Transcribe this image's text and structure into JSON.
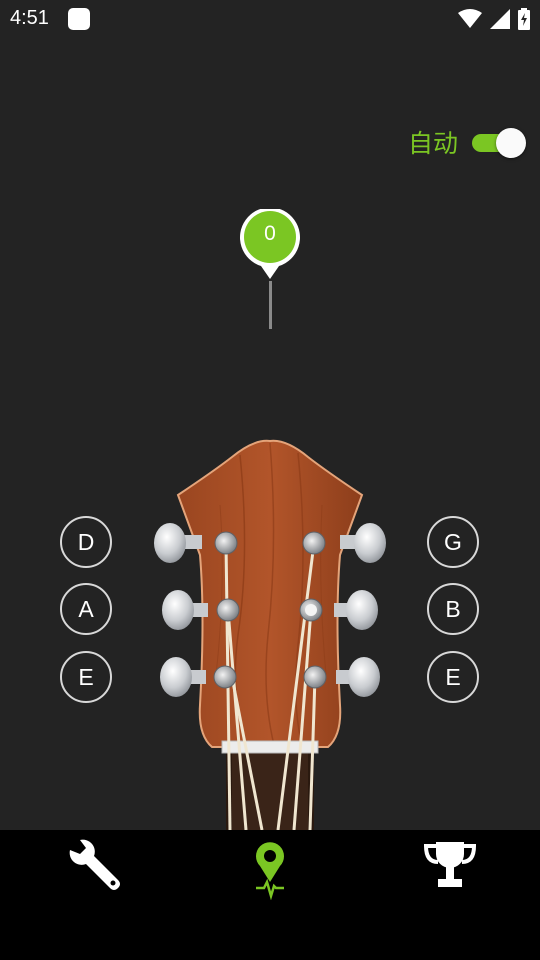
{
  "status_bar": {
    "time": "4:51",
    "icons": [
      "app-notification-icon",
      "wifi-icon",
      "signal-icon",
      "battery-charging-icon"
    ]
  },
  "tuner": {
    "auto_label": "自动",
    "auto_enabled": true,
    "deviation_value": "0",
    "accent_color": "#7bc623"
  },
  "strings": {
    "left": [
      {
        "note": "D"
      },
      {
        "note": "A"
      },
      {
        "note": "E"
      }
    ],
    "right": [
      {
        "note": "G"
      },
      {
        "note": "B"
      },
      {
        "note": "E"
      }
    ]
  },
  "bottom_nav": {
    "items": [
      {
        "name": "settings",
        "icon": "wrench-icon"
      },
      {
        "name": "tuner",
        "icon": "tuner-pin-icon",
        "active": true
      },
      {
        "name": "achievements",
        "icon": "trophy-icon"
      }
    ]
  }
}
